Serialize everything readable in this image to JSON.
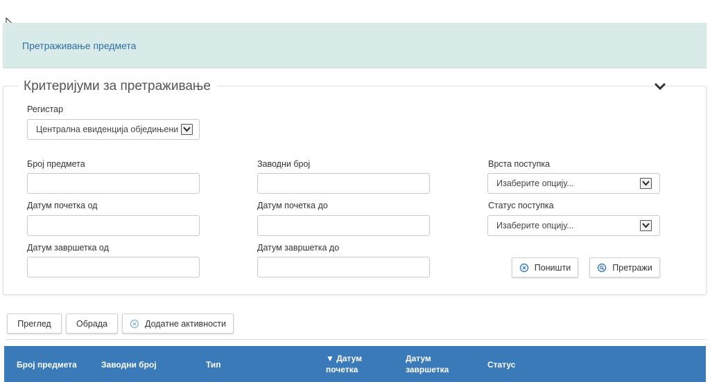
{
  "header": {
    "title": "Претраживање предмета"
  },
  "criteria": {
    "legend": "Критеријуми за претраживање",
    "registry_label": "Регистар",
    "registry_value": "Централна евиденција обједињени",
    "case_number_label": "Број предмета",
    "filing_number_label": "Заводни број",
    "procedure_type_label": "Врста поступка",
    "procedure_type_value": "Изаберите опцију...",
    "start_from_label": "Датум почетка од",
    "start_to_label": "Датум почетка до",
    "procedure_status_label": "Статус поступка",
    "procedure_status_value": "Изаберите опцију...",
    "end_from_label": "Датум завршетка од",
    "end_to_label": "Датум завршетка до",
    "cancel_label": "Поништи",
    "search_label": "Претражи"
  },
  "toolbar": {
    "preview_label": "Преглед",
    "processing_label": "Обрада",
    "extra_label": "Додатне активности"
  },
  "table": {
    "columns": [
      {
        "line1": "Број предмета",
        "line2": ""
      },
      {
        "line1": "Заводни број",
        "line2": ""
      },
      {
        "line1": "Тип",
        "line2": ""
      },
      {
        "line1": "▼ Датум",
        "line2": "почетка"
      },
      {
        "line1": "Датум",
        "line2": "завршетка"
      },
      {
        "line1": "Статус",
        "line2": ""
      }
    ]
  }
}
